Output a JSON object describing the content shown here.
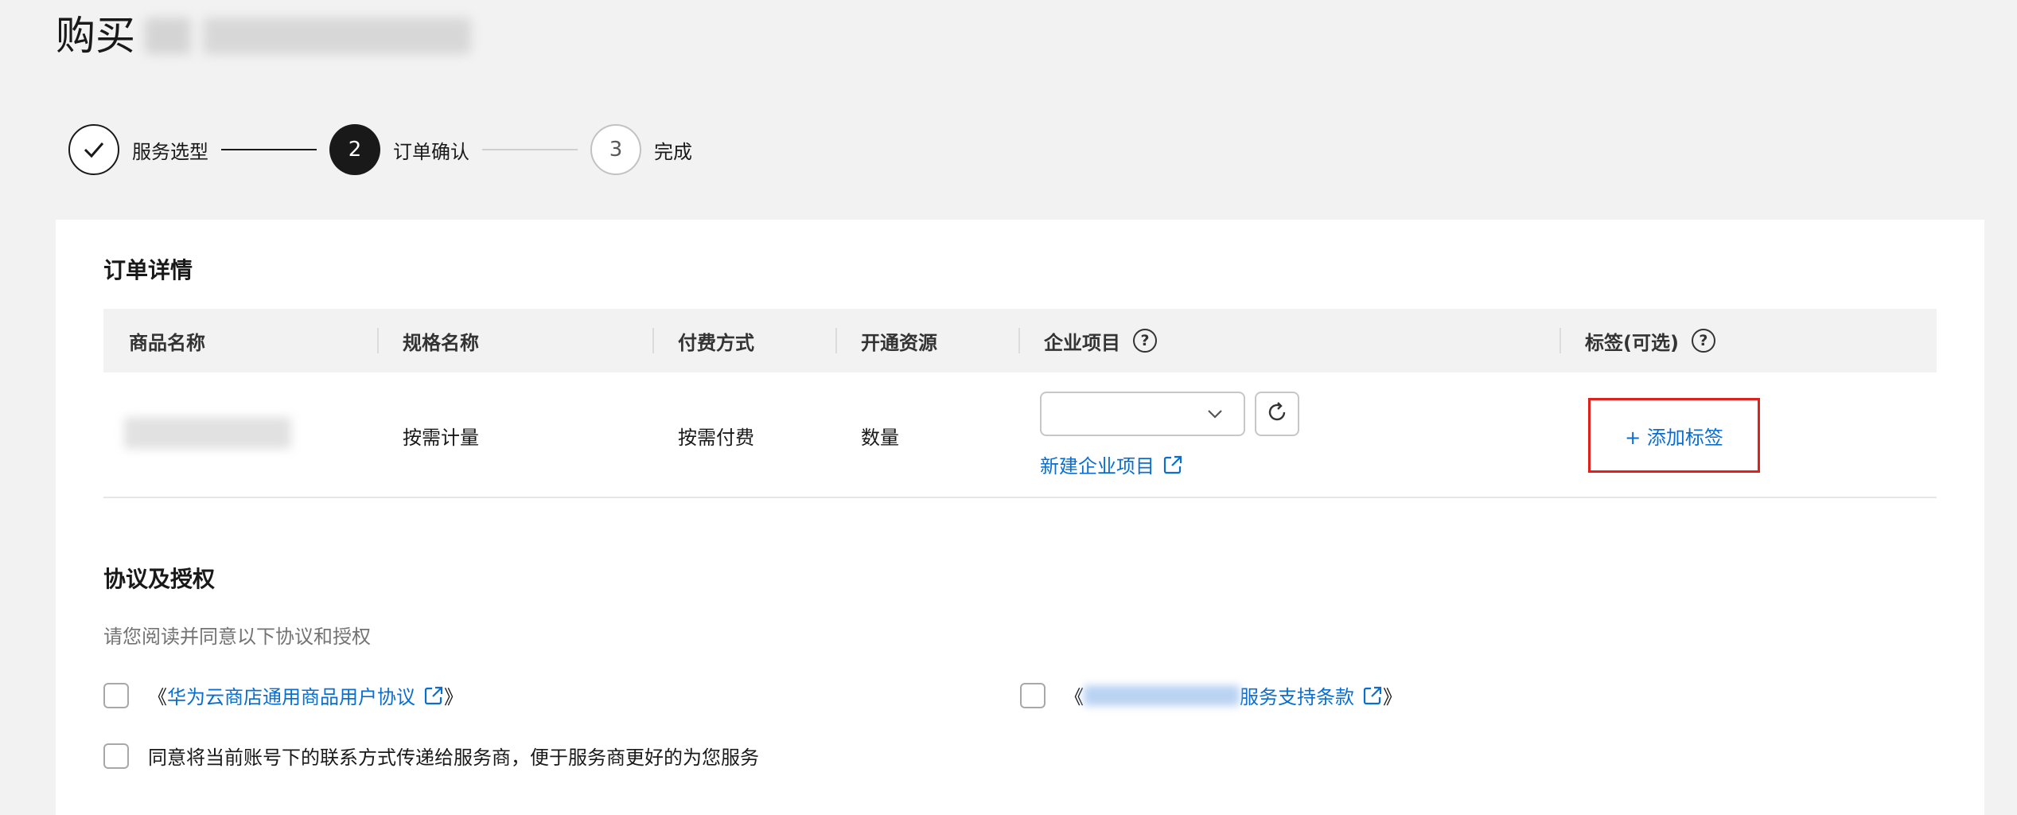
{
  "header": {
    "title": "购买"
  },
  "steps": [
    {
      "number": "",
      "label": "服务选型",
      "state": "done"
    },
    {
      "number": "2",
      "label": "订单确认",
      "state": "active"
    },
    {
      "number": "3",
      "label": "完成",
      "state": "todo"
    }
  ],
  "order": {
    "title": "订单详情",
    "columns": [
      "商品名称",
      "规格名称",
      "付费方式",
      "开通资源",
      "企业项目",
      "标签(可选)"
    ],
    "row": {
      "spec": "按需计量",
      "billing": "按需付费",
      "resource": "数量",
      "project_select_value": "",
      "new_project_link": "新建企业项目",
      "add_tag_link": "+ 添加标签"
    }
  },
  "agreement": {
    "title": "协议及授权",
    "hint": "请您阅读并同意以下协议和授权",
    "items": [
      {
        "open": "《",
        "link": "华为云商店通用商品用户协议",
        "close": "》"
      },
      {
        "open": "《",
        "link": "服务支持条款",
        "close": "》"
      },
      {
        "text": "同意将当前账号下的联系方式传递给服务商，便于服务商更好的为您服务"
      }
    ]
  },
  "colors": {
    "link": "#0a6ed1",
    "highlight_border": "#e0201d",
    "active_step": "#191919"
  },
  "icons": [
    "check-icon",
    "help-icon",
    "chevron-down-icon",
    "refresh-icon",
    "external-link-icon"
  ]
}
